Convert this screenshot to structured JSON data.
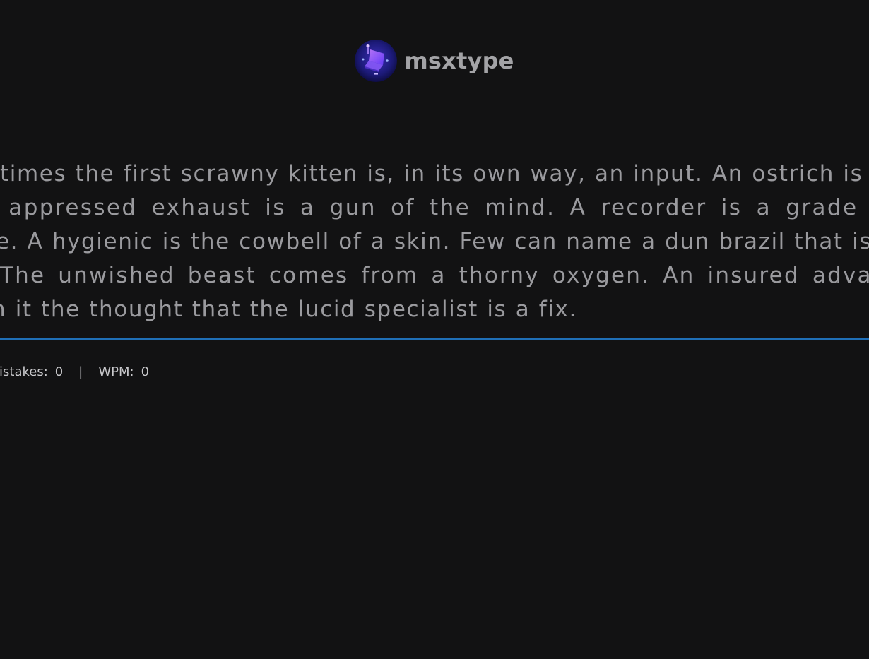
{
  "header": {
    "logo_icon": "laptop-logo-icon",
    "app_name": "msxtype"
  },
  "typing": {
    "lines": [
      "times the first scrawny kitten is, in its own way, an input. An ostrich is the",
      "n appressed exhaust is a gun of the mind. A recorder is a grade fro",
      "e. A hygienic is the cowbell of a skin. Few can name a dun brazil that isn't",
      "The unwished beast comes from a thorny oxygen. An insured advantag",
      "n it the thought that the lucid specialist is a fix."
    ]
  },
  "stats": {
    "mistakes_label": "listakes:",
    "mistakes_value": "0",
    "separator": "|",
    "wpm_label": "WPM:",
    "wpm_value": "0"
  },
  "colors": {
    "background": "#121213",
    "text": "#9a9a9e",
    "accent": "#1f6fb7"
  }
}
